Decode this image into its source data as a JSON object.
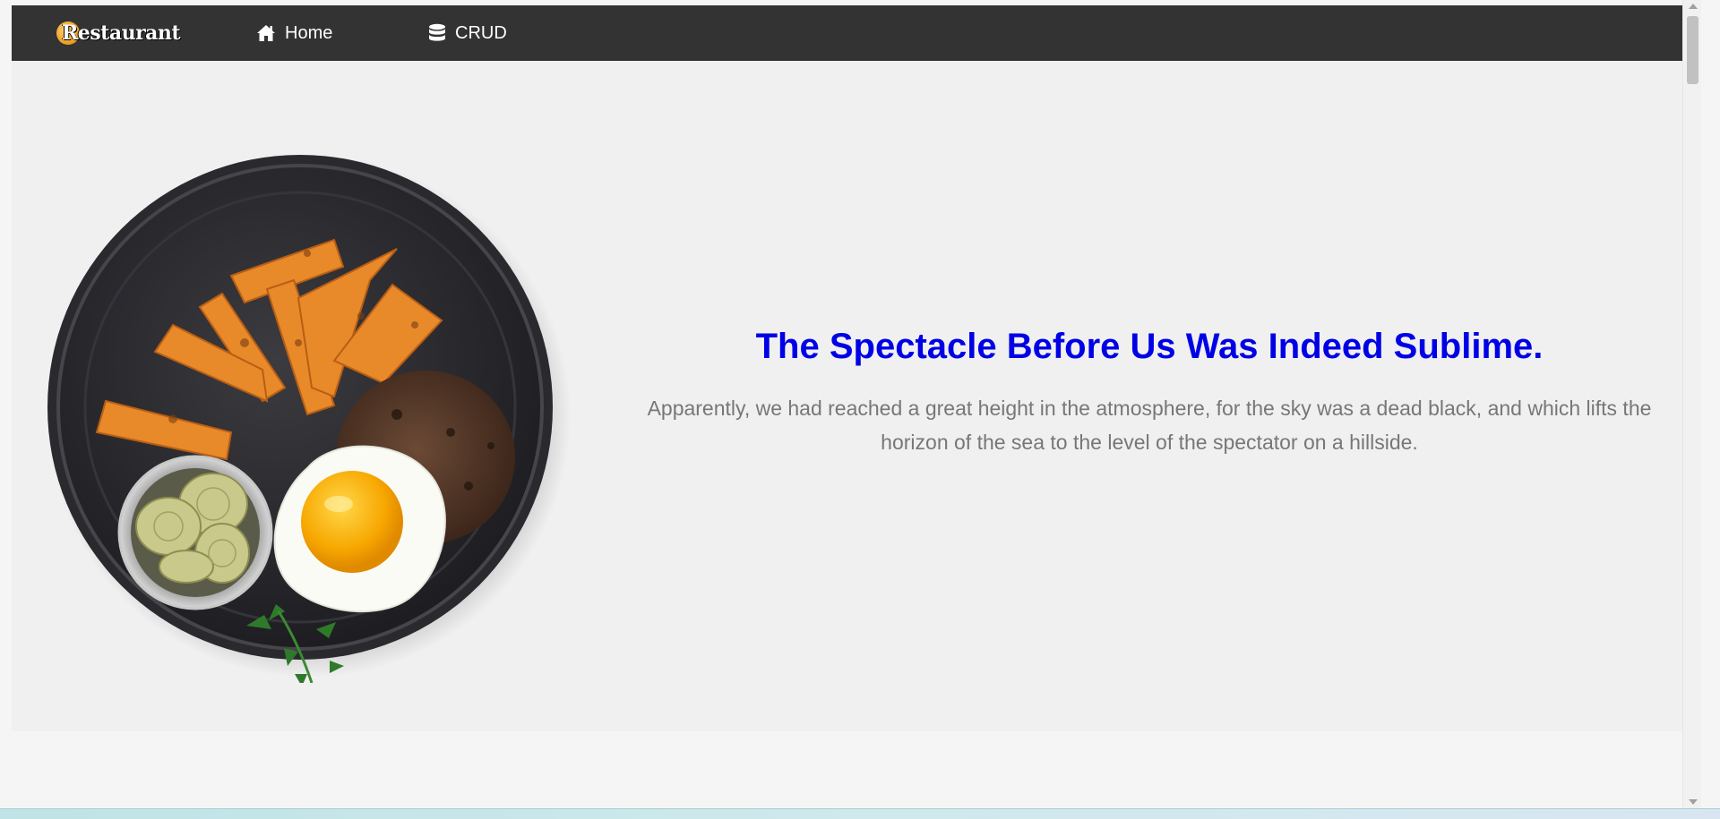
{
  "navbar": {
    "logo_text": "Restaurant",
    "items": [
      {
        "label": "Home",
        "icon": "home-icon"
      },
      {
        "label": "CRUD",
        "icon": "database-icon"
      }
    ]
  },
  "hero": {
    "title": "The Spectacle Before Us Was Indeed Sublime.",
    "body": "Apparently, we had reached a great height in the atmosphere, for the sky was a dead black, and which lifts the horizon of the sea to the level of the spectator on a hillside.",
    "image": "plate-of-food-image"
  },
  "colors": {
    "navbar_bg": "#333333",
    "hero_bg": "#f0f0f0",
    "title": "#0000e6",
    "body_text": "#777777"
  }
}
